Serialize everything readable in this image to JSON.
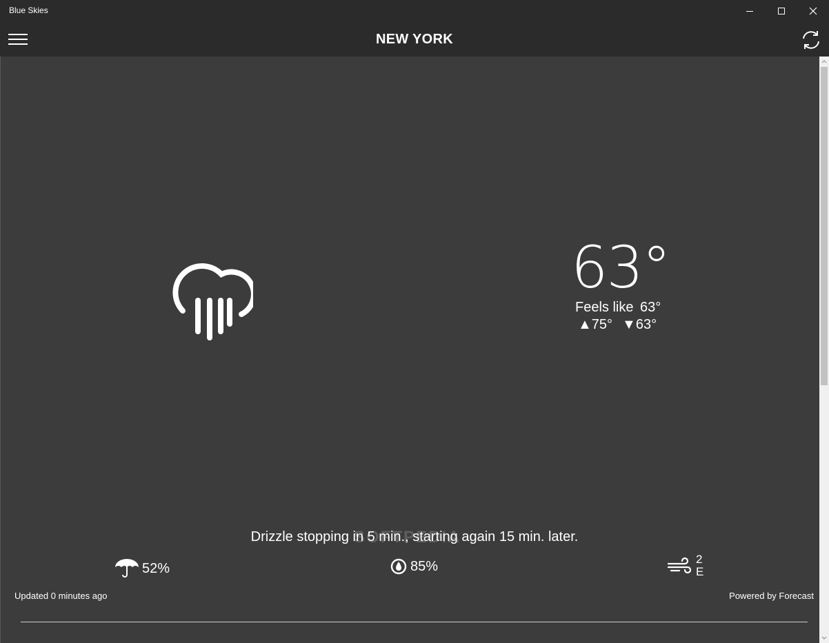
{
  "window": {
    "title": "Blue Skies"
  },
  "header": {
    "city": "NEW YORK"
  },
  "current": {
    "icon": "rain-cloud-icon",
    "temperature": "63°",
    "feels_like_label": "Feels like",
    "feels_like_value": "63°",
    "high_arrow": "▲",
    "high": "75°",
    "low_arrow": "▼",
    "low": "63°"
  },
  "summary": "Drizzle stopping in 5 min., starting again 15 min. later.",
  "watermark": "SOFTPEDIA",
  "stats": {
    "precipitation": {
      "icon": "umbrella-icon",
      "value": "52%"
    },
    "humidity": {
      "icon": "water-drop-icon",
      "value": "85%"
    },
    "wind": {
      "icon": "wind-icon",
      "speed": "2",
      "direction": "E"
    }
  },
  "footer": {
    "updated": "Updated 0 minutes ago",
    "powered_by": "Powered by Forecast"
  }
}
